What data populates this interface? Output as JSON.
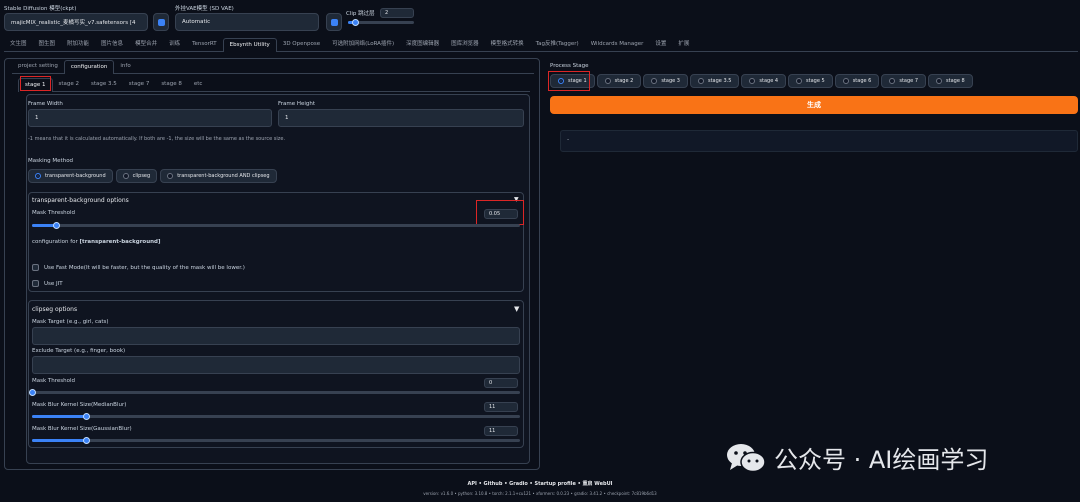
{
  "top": {
    "checkpoint_label": "Stable Diffusion 模型(ckpt)",
    "checkpoint_value": "majicMIX_realistic_麦橘写实_v7.safetensors [4",
    "vae_label": "外挂VAE模型 (SD VAE)",
    "vae_value": "Automatic",
    "clip_label": "Clip 跳过层",
    "clip_value": "2",
    "clip_level": 0.1
  },
  "main_tabs": [
    "文生图",
    "图生图",
    "附加功能",
    "图片信息",
    "模型合并",
    "训练",
    "TensorRT",
    "Ebsynth Utility",
    "3D Openpose",
    "可选附加网络(LoRA插件)",
    "深度图编辑器",
    "图库浏览器",
    "模型格式转换",
    "Tag反推(Tagger)",
    "Wildcards Manager",
    "设置",
    "扩展"
  ],
  "active_main_tab": "Ebsynth Utility",
  "sub_tabs": [
    "project setting",
    "configuration",
    "info"
  ],
  "active_sub_tab": "configuration",
  "stage_tabs": [
    "stage 1",
    "stage 2",
    "stage 3.5",
    "stage 7",
    "stage 8",
    "etc"
  ],
  "active_stage_tab": "stage 1",
  "frame_width": {
    "label": "Frame Width",
    "value": "1"
  },
  "frame_height": {
    "label": "Frame Height",
    "value": "1"
  },
  "size_note": "-1 means that it is calculated automatically. If both are -1, the size will be the same as the source size.",
  "masking": {
    "label": "Masking Method",
    "options": [
      "transparent-background",
      "clipseg",
      "transparent-background AND clipseg"
    ],
    "selected": "transparent-background"
  },
  "tb_options": {
    "title": "transparent-background options",
    "threshold_label": "Mask Threshold",
    "threshold_value": "0.05",
    "threshold_level": 0.05,
    "config_prefix": "configuration for ",
    "config_name": "[transparent-background]",
    "fast_mode_label": "Use Fast Mode(It will be faster, but the quality of the mask will be lower.)",
    "jit_label": "Use JIT"
  },
  "clipseg": {
    "title": "clipseg options",
    "target_label": "Mask Target (e.g., girl, cats)",
    "exclude_label": "Exclude Target (e.g., finger, book)",
    "threshold_label": "Mask Threshold",
    "threshold_value": "0",
    "threshold_level": 0.0,
    "median_label": "Mask Blur Kernel Size(MedianBlur)",
    "median_value": "11",
    "median_level": 0.11,
    "gauss_label": "Mask Blur Kernel Size(GaussianBlur)",
    "gauss_value": "11",
    "gauss_level": 0.11
  },
  "process_stage": {
    "label": "Process Stage",
    "options": [
      "stage 1",
      "stage 2",
      "stage 3",
      "stage 3.5",
      "stage 4",
      "stage 5",
      "stage 6",
      "stage 7",
      "stage 8"
    ],
    "selected": "stage 1"
  },
  "generate_label": "生成",
  "output_text": "-",
  "footer": {
    "links": "API • Github • Gradio • Startup profile • 重启 WebUI",
    "versions": "version: v1.6.0 • python: 3.10.8 • torch: 2.1.1+cu121 • xformers: 0.0.23 • gradio: 3.41.2 • checkpoint: 7c819b6d13"
  },
  "watermark": "公众号 · AI绘画学习",
  "colors": {
    "accent": "#f97316",
    "primary": "#3b82f6",
    "highlight": "#dc2626",
    "background": "#0b0f19"
  }
}
